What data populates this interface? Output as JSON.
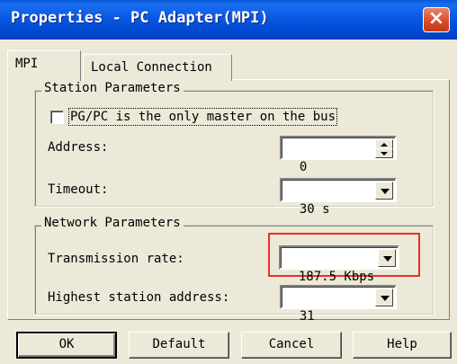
{
  "window": {
    "title": "Properties - PC Adapter(MPI)",
    "close_glyph": "×"
  },
  "tabs": [
    {
      "label": "MPI",
      "active": true
    },
    {
      "label": "Local Connection",
      "active": false
    }
  ],
  "station_parameters": {
    "group_label": "Station Parameters",
    "only_master": {
      "label": "PG/PC is the only master on the bus",
      "checked": false
    },
    "address": {
      "label": "Address:",
      "value": "0"
    },
    "timeout": {
      "label": "Timeout:",
      "value": "30 s"
    }
  },
  "network_parameters": {
    "group_label": "Network Parameters",
    "transmission_rate": {
      "label": "Transmission rate:",
      "value": "187.5 Kbps"
    },
    "highest_station_address": {
      "label": "Highest station address:",
      "value": "31"
    }
  },
  "buttons": {
    "ok": "OK",
    "default": "Default",
    "cancel": "Cancel",
    "help": "Help"
  },
  "colors": {
    "titlebar": "#0a58e4",
    "highlight_box": "#e8302a",
    "dialog_bg": "#ece9d8"
  }
}
